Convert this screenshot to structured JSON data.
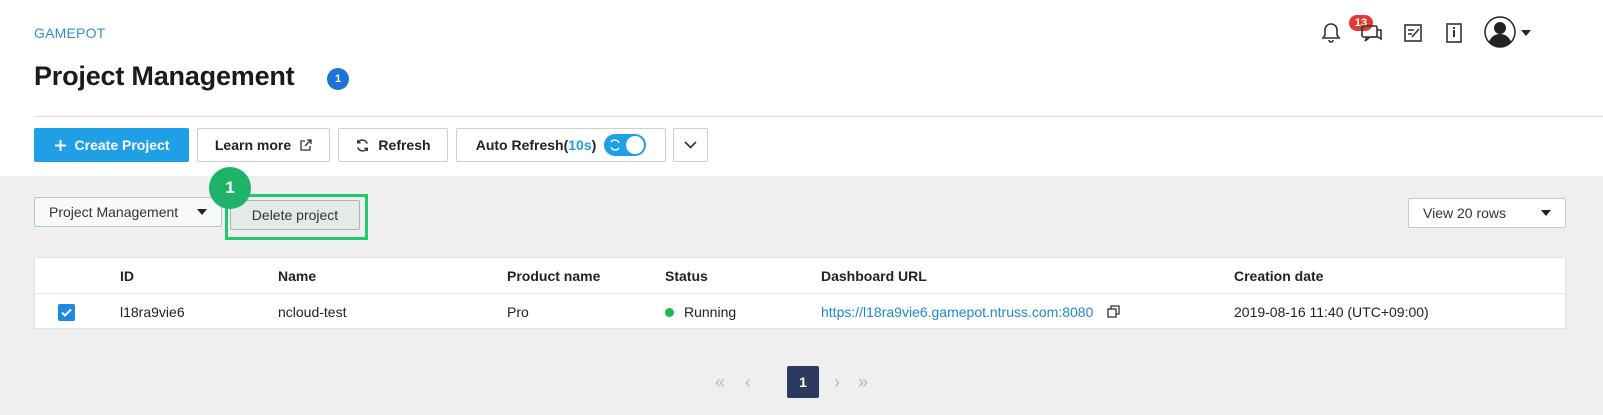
{
  "header": {
    "breadcrumb": "GAMEPOT",
    "title": "Project Management",
    "title_badge": "1",
    "notification_count": "13"
  },
  "toolbar": {
    "create_label": "Create Project",
    "learn_more_label": "Learn more",
    "refresh_label": "Refresh",
    "auto_refresh_label": "Auto Refresh(",
    "auto_refresh_interval": "10s",
    "auto_refresh_close": ")"
  },
  "filters": {
    "project_select": "Project Management",
    "delete_label": "Delete project",
    "step_marker": "1",
    "rows_select": "View 20 rows"
  },
  "table": {
    "columns": [
      "ID",
      "Name",
      "Product name",
      "Status",
      "Dashboard URL",
      "Creation date"
    ],
    "rows": [
      {
        "checked": true,
        "id": "l18ra9vie6",
        "name": "ncloud-test",
        "product": "Pro",
        "status": "Running",
        "url": "https://l18ra9vie6.gamepot.ntruss.com:8080",
        "created": "2019-08-16 11:40 (UTC+09:00)"
      }
    ]
  },
  "pagination": {
    "first": "«",
    "prev": "‹",
    "current": "1",
    "next": "›",
    "last": "»"
  },
  "colors": {
    "primary": "#1e9fe6",
    "highlight": "#22c86e",
    "running": "#1db954",
    "badge": "#e53935"
  }
}
